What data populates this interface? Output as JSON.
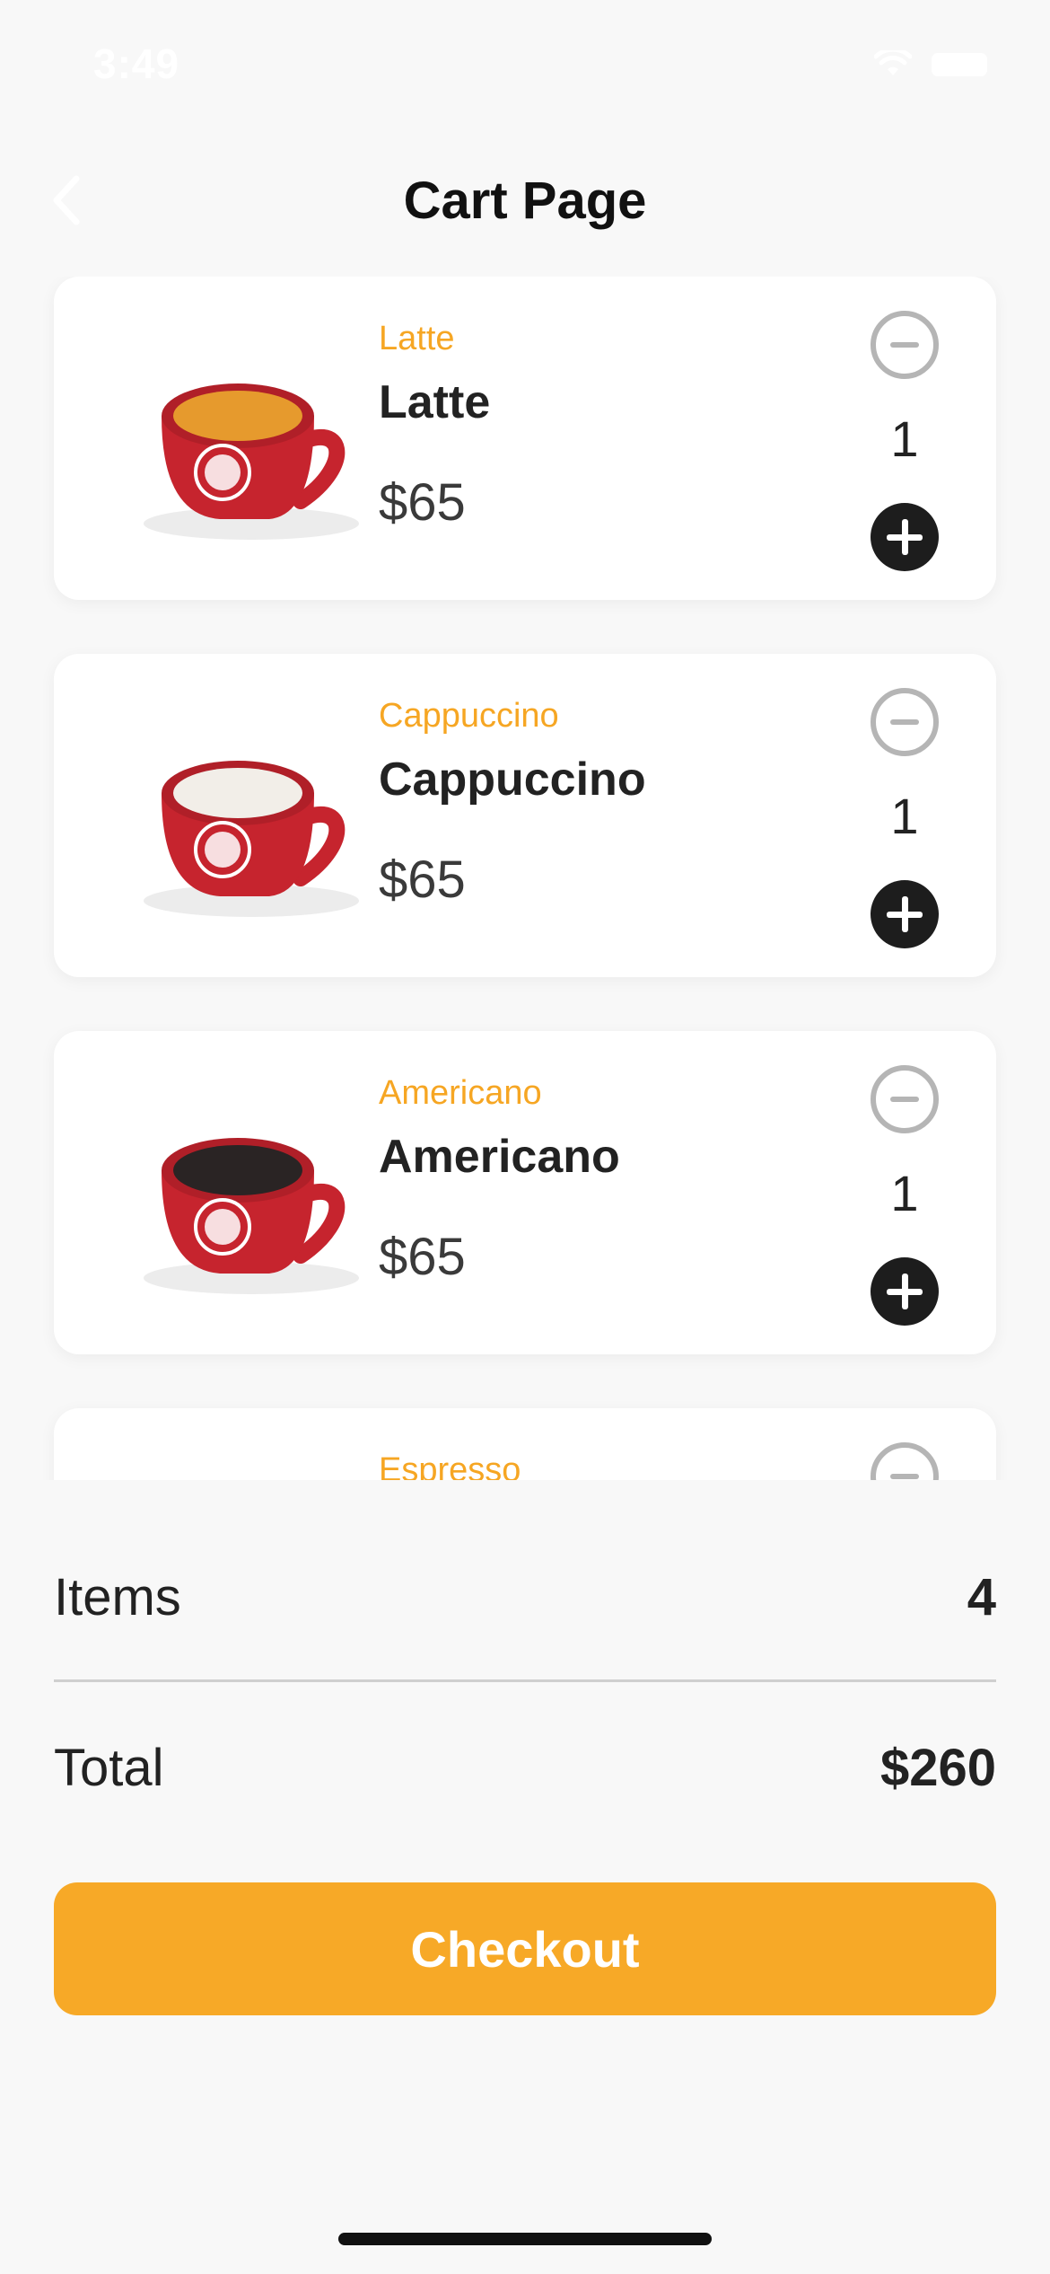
{
  "status_bar": {
    "time": "3:49"
  },
  "header": {
    "title": "Cart Page"
  },
  "cart_items": [
    {
      "subtitle": "Latte",
      "name": "Latte",
      "price": "$65",
      "quantity": "1",
      "coffee_color": "#e69a2d"
    },
    {
      "subtitle": "Cappuccino",
      "name": "Cappuccino",
      "price": "$65",
      "quantity": "1",
      "coffee_color": "#f2eee8"
    },
    {
      "subtitle": "Americano",
      "name": "Americano",
      "price": "$65",
      "quantity": "1",
      "coffee_color": "#2a2424"
    },
    {
      "subtitle": "Espresso",
      "name": "",
      "price": "",
      "quantity": "",
      "coffee_color": "#6a3d1d"
    }
  ],
  "summary": {
    "items_label": "Items",
    "items_value": "4",
    "total_label": "Total",
    "total_value": "$260"
  },
  "checkout": {
    "label": "Checkout"
  },
  "colors": {
    "accent": "#f7a927",
    "background": "#f8f8f8",
    "card": "#ffffff",
    "cup_red": "#c6242e"
  }
}
